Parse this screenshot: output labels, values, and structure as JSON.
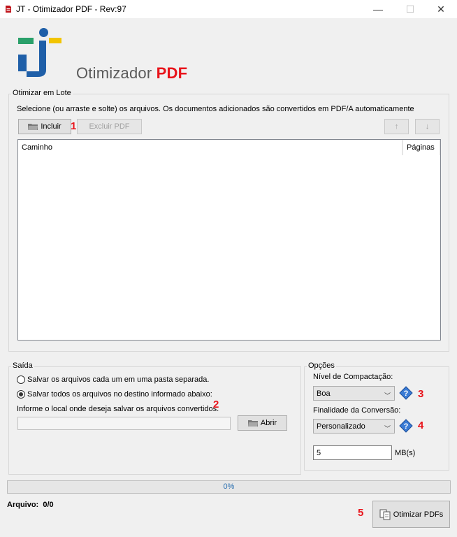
{
  "window": {
    "title": "JT - Otimizador PDF - Rev:97",
    "minimize": "—",
    "maximize": "☐",
    "close": "✕"
  },
  "header": {
    "app_name_prefix": "Otimizador ",
    "app_name_suffix": "PDF"
  },
  "batch": {
    "group_label": "Otimizar em Lote",
    "instructions": "Selecione (ou arraste e solte) os arquivos. Os documentos adicionados são convertidos em PDF/A automaticamente",
    "include_label": "Incluir",
    "exclude_label": "Excluir PDF",
    "move_up": "↑",
    "move_down": "↓",
    "marker": "1",
    "columns": [
      "Caminho",
      "Páginas"
    ],
    "rows": []
  },
  "output": {
    "group_label": "Saída",
    "option_separate": "Salvar os arquivos cada um em uma pasta separada.",
    "option_all": "Salvar todos os arquivos no destino informado abaixo:",
    "selected_option": "option_all",
    "destination_label": "Informe o local onde deseja salvar os arquivos convertidos.",
    "destination_value": "",
    "open_label": "Abrir",
    "marker": "2"
  },
  "options": {
    "group_label": "Opções",
    "compression_label": "Nível de Compactação:",
    "compression_value": "Boa",
    "compression_marker": "3",
    "purpose_label": "Finalidade da Conversão:",
    "purpose_value": "Personalizado",
    "purpose_marker": "4",
    "size_value": "5",
    "size_unit": "MB(s)"
  },
  "status": {
    "progress_text": "0%",
    "progress_fraction": 0,
    "file_label": "Arquivo:",
    "file_count": "0/0"
  },
  "actions": {
    "optimize_label": "Otimizar PDFs",
    "marker": "5"
  },
  "colors": {
    "brand_red": "#e8141b",
    "logo_blue": "#1f5fa8",
    "logo_green": "#2aa06a",
    "logo_yellow": "#f2c400",
    "help_blue": "#3a7bd5"
  }
}
